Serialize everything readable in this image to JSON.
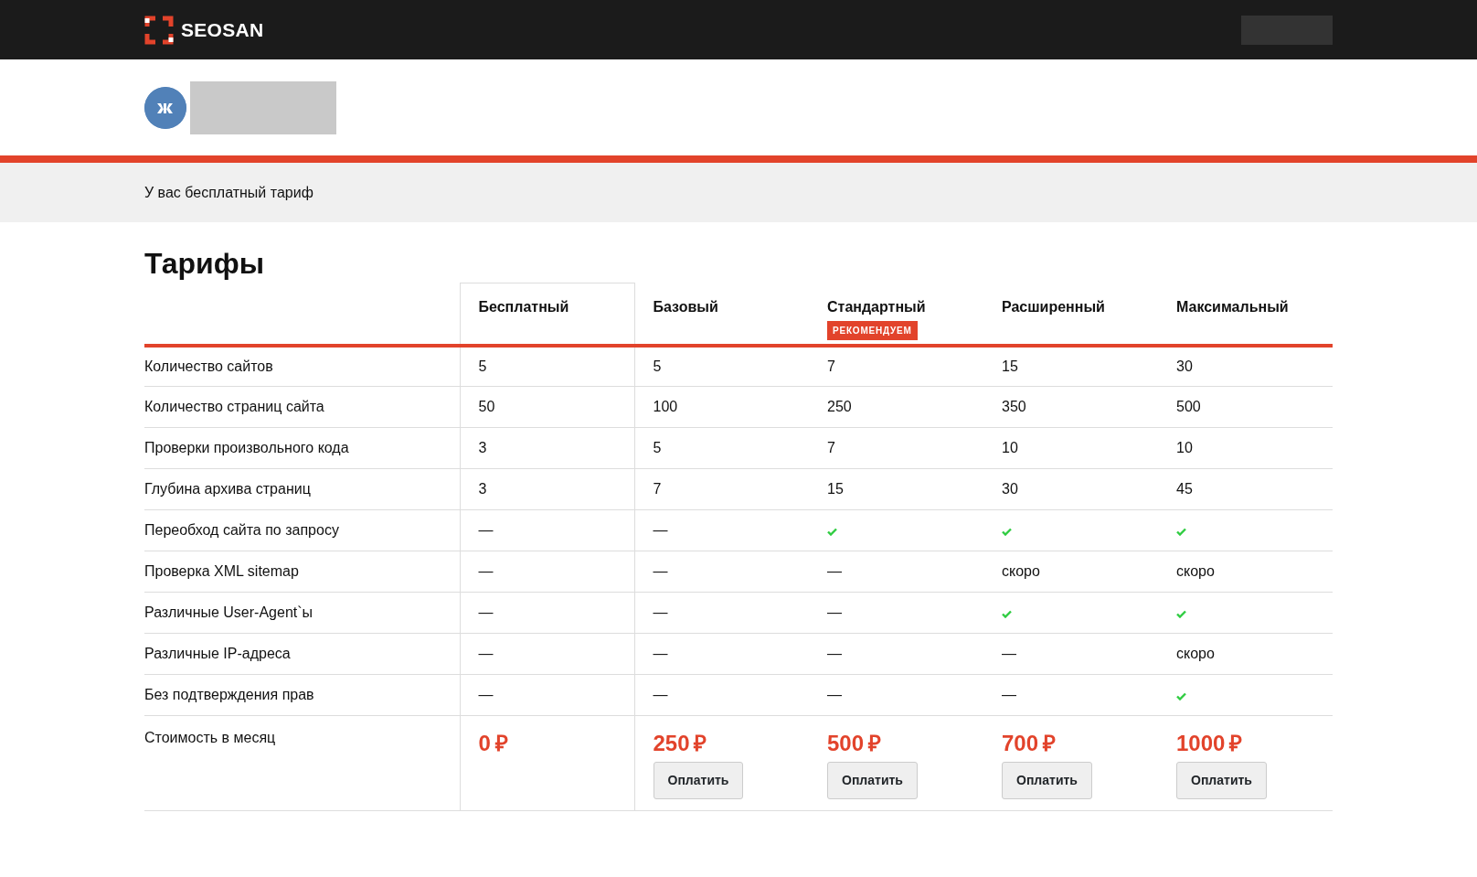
{
  "navbar": {
    "brand": "SEOSAN"
  },
  "notice": "У вас бесплатный тариф",
  "title": "Тарифы",
  "plans": [
    {
      "name": "Бесплатный",
      "selected": true,
      "price": "0",
      "currency": "₽"
    },
    {
      "name": "Базовый",
      "selected": false,
      "price": "250",
      "currency": "₽",
      "button": "Оплатить"
    },
    {
      "name": "Стандартный",
      "selected": false,
      "badge": "РЕКОМЕНДУЕМ",
      "price": "500",
      "currency": "₽",
      "button": "Оплатить"
    },
    {
      "name": "Расширенный",
      "selected": false,
      "price": "700",
      "currency": "₽",
      "button": "Оплатить"
    },
    {
      "name": "Максимальный",
      "selected": false,
      "price": "1000",
      "currency": "₽",
      "button": "Оплатить"
    }
  ],
  "features": [
    {
      "label": "Количество сайтов",
      "cells": [
        {
          "kind": "text",
          "text": "5"
        },
        {
          "kind": "text",
          "text": "5"
        },
        {
          "kind": "text",
          "text": "7"
        },
        {
          "kind": "text",
          "text": "15"
        },
        {
          "kind": "text",
          "text": "30"
        }
      ]
    },
    {
      "label": "Количество страниц сайта",
      "cells": [
        {
          "kind": "text",
          "text": "50"
        },
        {
          "kind": "text",
          "text": "100"
        },
        {
          "kind": "text",
          "text": "250"
        },
        {
          "kind": "text",
          "text": "350"
        },
        {
          "kind": "text",
          "text": "500"
        }
      ]
    },
    {
      "label": "Проверки произвольного кода",
      "cells": [
        {
          "kind": "text",
          "text": "3"
        },
        {
          "kind": "text",
          "text": "5"
        },
        {
          "kind": "text",
          "text": "7"
        },
        {
          "kind": "text",
          "text": "10"
        },
        {
          "kind": "text",
          "text": "10"
        }
      ]
    },
    {
      "label": "Глубина архива страниц",
      "cells": [
        {
          "kind": "text",
          "text": "3"
        },
        {
          "kind": "text",
          "text": "7"
        },
        {
          "kind": "text",
          "text": "15"
        },
        {
          "kind": "text",
          "text": "30"
        },
        {
          "kind": "text",
          "text": "45"
        }
      ]
    },
    {
      "label": "Переобход сайта по запросу",
      "cells": [
        {
          "kind": "text",
          "text": "—"
        },
        {
          "kind": "text",
          "text": "—"
        },
        {
          "kind": "check"
        },
        {
          "kind": "check"
        },
        {
          "kind": "check"
        }
      ]
    },
    {
      "label": "Проверка XML sitemap",
      "cells": [
        {
          "kind": "text",
          "text": "—"
        },
        {
          "kind": "text",
          "text": "—"
        },
        {
          "kind": "text",
          "text": "—"
        },
        {
          "kind": "text",
          "text": "скоро"
        },
        {
          "kind": "text",
          "text": "скоро"
        }
      ]
    },
    {
      "label": "Различные User-Agent`ы",
      "cells": [
        {
          "kind": "text",
          "text": "—"
        },
        {
          "kind": "text",
          "text": "—"
        },
        {
          "kind": "text",
          "text": "—"
        },
        {
          "kind": "check"
        },
        {
          "kind": "check"
        }
      ]
    },
    {
      "label": "Различные IP-адреса",
      "cells": [
        {
          "kind": "text",
          "text": "—"
        },
        {
          "kind": "text",
          "text": "—"
        },
        {
          "kind": "text",
          "text": "—"
        },
        {
          "kind": "text",
          "text": "—"
        },
        {
          "kind": "text",
          "text": "скоро"
        }
      ]
    },
    {
      "label": "Без подтверждения прав",
      "cells": [
        {
          "kind": "text",
          "text": "—"
        },
        {
          "kind": "text",
          "text": "—"
        },
        {
          "kind": "text",
          "text": "—"
        },
        {
          "kind": "text",
          "text": "—"
        },
        {
          "kind": "check"
        }
      ]
    }
  ],
  "price_row": {
    "label": "Стоимость в месяц"
  }
}
